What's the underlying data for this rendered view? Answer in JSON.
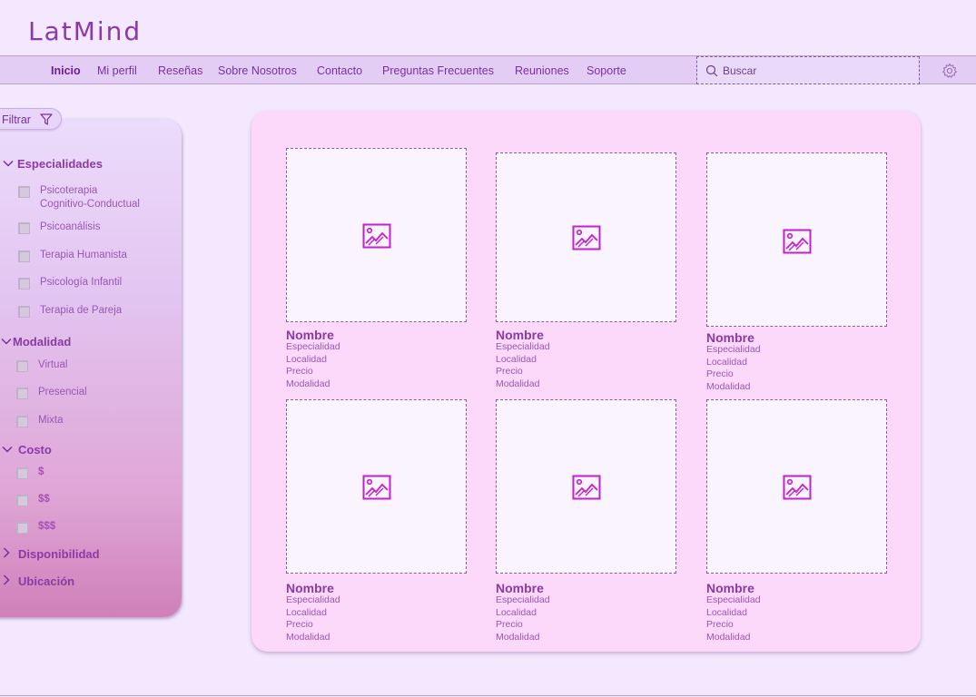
{
  "app": {
    "logo": "LatMind"
  },
  "nav": {
    "items": [
      "Inicio",
      "Mi perfil",
      "Reseñas",
      "Sobre Nosotros",
      "Contacto",
      "Preguntas Frecuentes",
      "Reuniones",
      "Soporte"
    ],
    "active": "Inicio"
  },
  "search": {
    "placeholder": "Buscar"
  },
  "icons": {
    "search": "search-icon",
    "settings": "gear-icon",
    "filter": "filter-icon",
    "image": "image-placeholder-icon"
  },
  "filter": {
    "label": "Filtrar",
    "sections": {
      "especialidades": {
        "title": "Especialidades",
        "options": [
          "Psicoterapia\nCognitivo-Conductual",
          "Psicoanálisis",
          "Terapia Humanista",
          "Psicología Infantil",
          "Terapia de Pareja"
        ]
      },
      "modalidad": {
        "title": "Modalidad",
        "options": [
          "Virtual",
          "Presencial",
          "Mixta"
        ]
      },
      "costo": {
        "title": "Costo",
        "options": [
          "$",
          "$$",
          "$$$"
        ]
      },
      "disponibilidad": {
        "title": "Disponibilidad"
      },
      "ubicacion": {
        "title": "Ubicación"
      }
    }
  },
  "cards": [
    {
      "name": "Nombre",
      "specialty": "Especialidad",
      "location": "Localidad",
      "price": "Precio",
      "modality": "Modalidad"
    },
    {
      "name": "Nombre",
      "specialty": "Especialidad",
      "location": "Localidad",
      "price": "Precio",
      "modality": "Modalidad"
    },
    {
      "name": "Nombre",
      "specialty": "Especialidad",
      "location": "Localidad",
      "price": "Precio",
      "modality": "Modalidad"
    },
    {
      "name": "Nombre",
      "specialty": "Especialidad",
      "location": "Localidad",
      "price": "Precio",
      "modality": "Modalidad"
    },
    {
      "name": "Nombre",
      "specialty": "Especialidad",
      "location": "Localidad",
      "price": "Precio",
      "modality": "Modalidad"
    },
    {
      "name": "Nombre",
      "specialty": "Especialidad",
      "location": "Localidad",
      "price": "Precio",
      "modality": "Modalidad"
    }
  ],
  "colors": {
    "brand": "#8a3aa6",
    "nav_bg": "#e3cdf5",
    "panel_bg": "#fcd8fa",
    "page_bg": "#f3e8fd",
    "icon_accent": "#c41fcf"
  }
}
